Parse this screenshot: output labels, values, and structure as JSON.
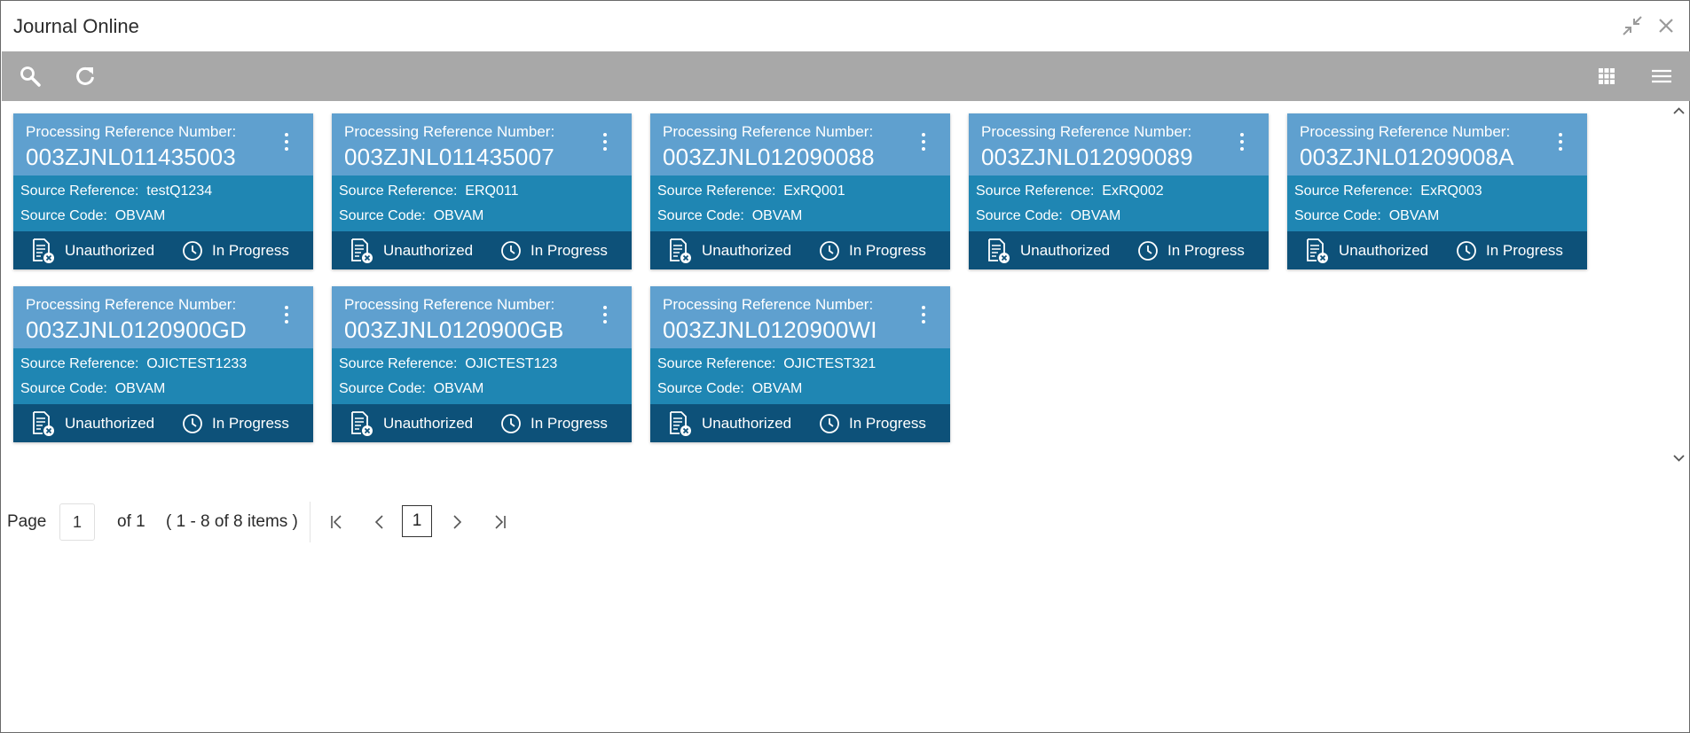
{
  "window": {
    "title": "Journal Online"
  },
  "labels": {
    "processing_ref": "Processing Reference Number:",
    "source_ref": "Source Reference:",
    "source_code": "Source Code:"
  },
  "cards": [
    {
      "ref_no": "003ZJNL011435003",
      "source_ref": "testQ1234",
      "source_code": "OBVAM",
      "auth_status": "Unauthorized",
      "progress_status": "In Progress"
    },
    {
      "ref_no": "003ZJNL011435007",
      "source_ref": "ERQ011",
      "source_code": "OBVAM",
      "auth_status": "Unauthorized",
      "progress_status": "In Progress"
    },
    {
      "ref_no": "003ZJNL012090088",
      "source_ref": "ExRQ001",
      "source_code": "OBVAM",
      "auth_status": "Unauthorized",
      "progress_status": "In Progress"
    },
    {
      "ref_no": "003ZJNL012090089",
      "source_ref": "ExRQ002",
      "source_code": "OBVAM",
      "auth_status": "Unauthorized",
      "progress_status": "In Progress"
    },
    {
      "ref_no": "003ZJNL01209008A",
      "source_ref": "ExRQ003",
      "source_code": "OBVAM",
      "auth_status": "Unauthorized",
      "progress_status": "In Progress"
    },
    {
      "ref_no": "003ZJNL0120900GD",
      "source_ref": "OJICTEST1233",
      "source_code": "OBVAM",
      "auth_status": "Unauthorized",
      "progress_status": "In Progress"
    },
    {
      "ref_no": "003ZJNL0120900GB",
      "source_ref": "OJICTEST123",
      "source_code": "OBVAM",
      "auth_status": "Unauthorized",
      "progress_status": "In Progress"
    },
    {
      "ref_no": "003ZJNL0120900WI",
      "source_ref": "OJICTEST321",
      "source_code": "OBVAM",
      "auth_status": "Unauthorized",
      "progress_status": "In Progress"
    }
  ],
  "pagination": {
    "page_label": "Page",
    "page_value": "1",
    "of_label": "of 1",
    "items_label": "( 1 - 8 of 8 items )",
    "current_page": "1"
  },
  "colors": {
    "card_header": "#5fa0cf",
    "card_body": "#1f86b3",
    "card_footer": "#0d5179",
    "toolbar": "#a8a8a8"
  },
  "icons": {
    "toolbar": [
      "search-icon",
      "refresh-icon",
      "grid-view-icon",
      "list-view-icon"
    ],
    "card": [
      "kebab-menu-icon",
      "unauthorized-document-icon",
      "clock-icon"
    ],
    "window": [
      "minimize-icon",
      "close-icon"
    ]
  }
}
